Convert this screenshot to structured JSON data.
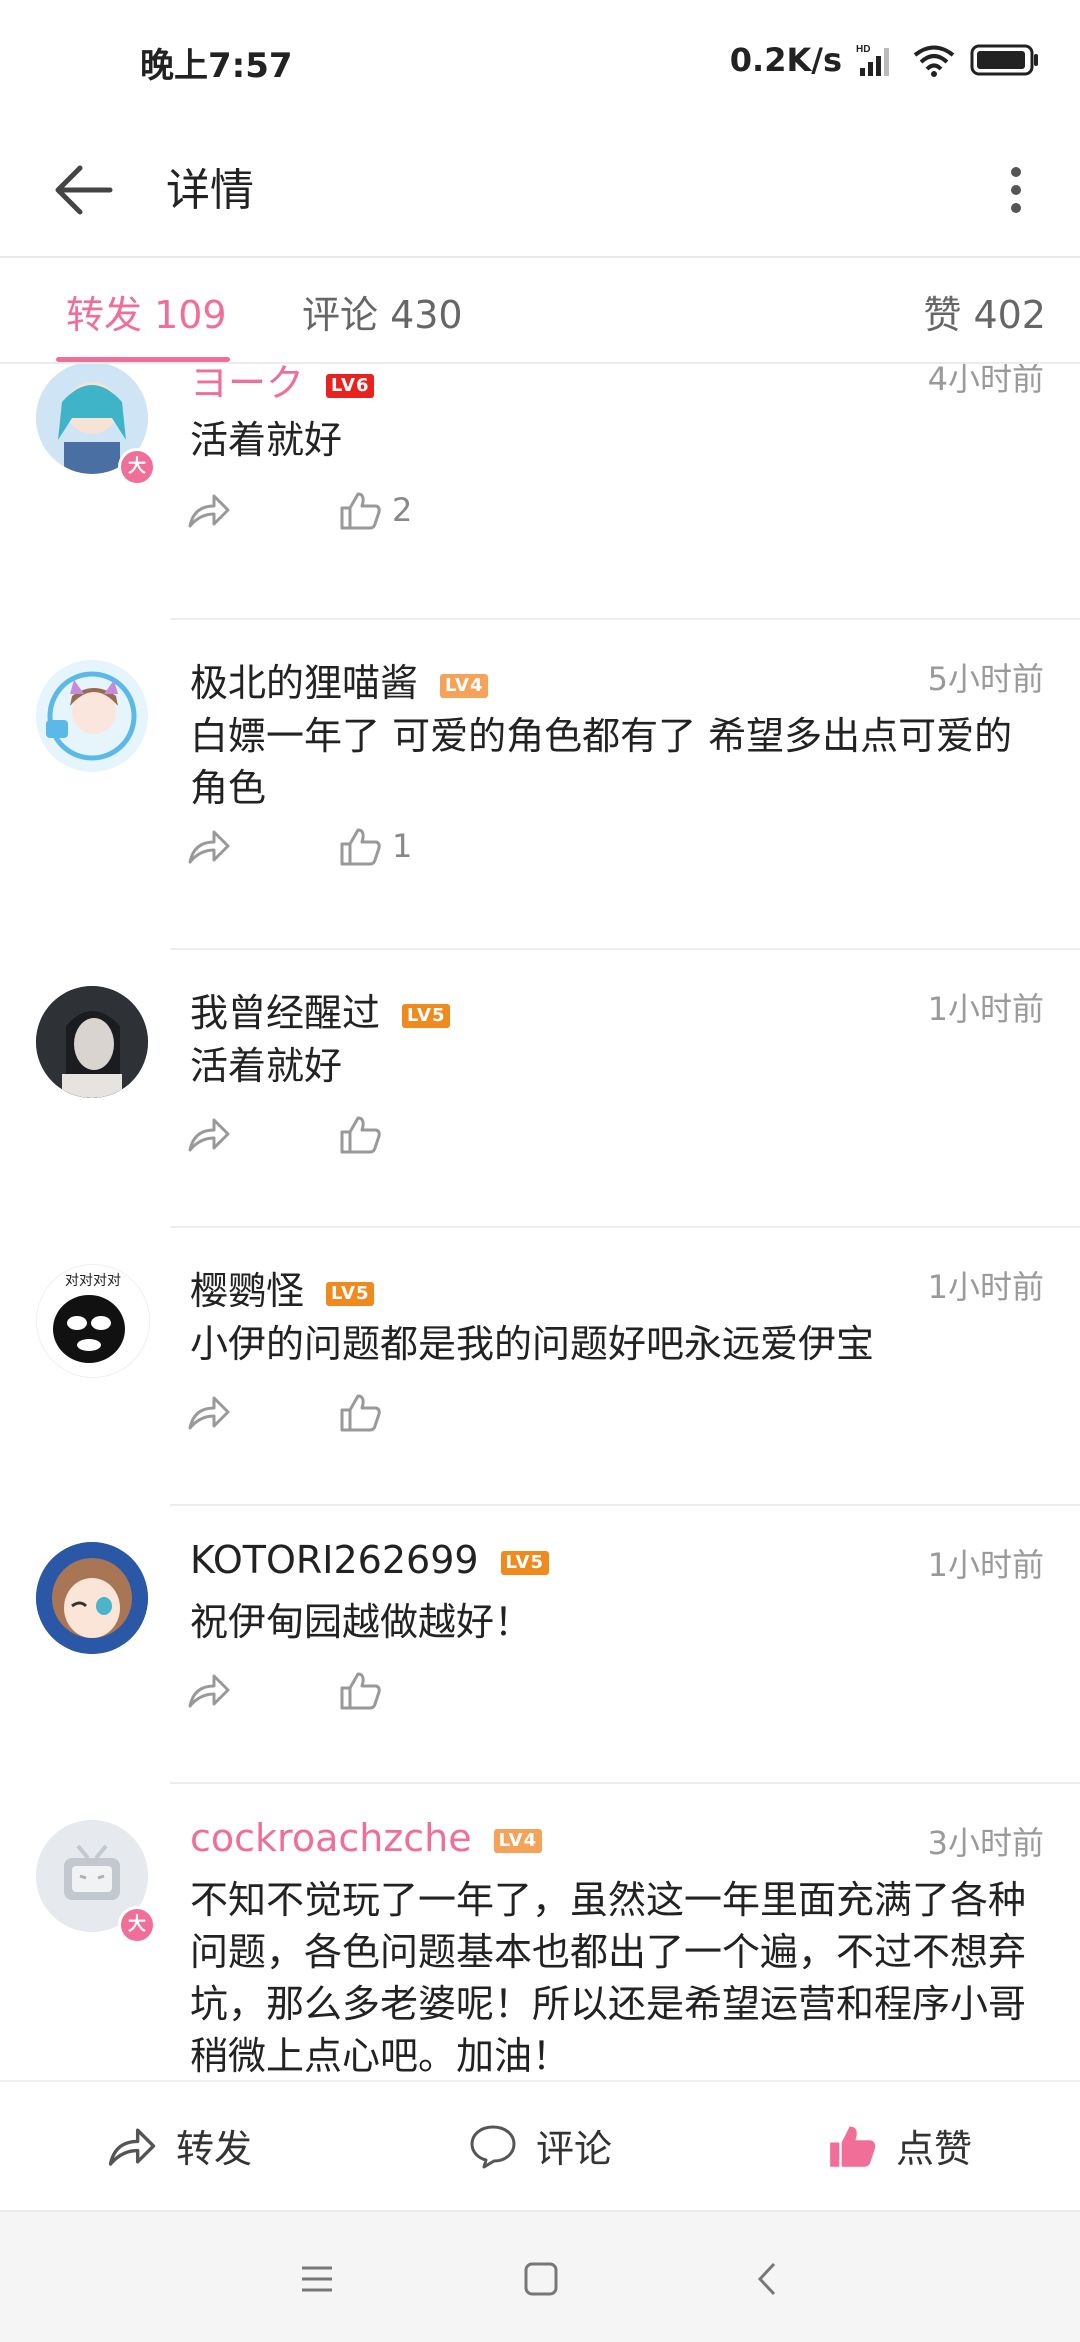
{
  "status": {
    "time": "晚上7:57",
    "net_speed": "0.2K/s"
  },
  "header": {
    "title": "详情"
  },
  "tabs": [
    {
      "label": "转发 109"
    },
    {
      "label": "评论 430"
    },
    {
      "label": "赞 402"
    }
  ],
  "comments": [
    {
      "username": "ヨーク",
      "level": "LV6",
      "time": "4小时前",
      "text": "活着就好",
      "likes": "2"
    },
    {
      "username": "极北的狸喵酱",
      "level": "LV4",
      "time": "5小时前",
      "text": "白嫖一年了 可爱的角色都有了 希望多出点可爱的角色",
      "likes": "1"
    },
    {
      "username": "我曾经醒过",
      "level": "LV5",
      "time": "1小时前",
      "text": "活着就好",
      "likes": ""
    },
    {
      "username": "樱鹦怪",
      "level": "LV5",
      "time": "1小时前",
      "text": "小伊的问题都是我的问题好吧永远爱伊宝",
      "likes": "",
      "avatar_text": "对对对对"
    },
    {
      "username": "KOTORI262699",
      "level": "LV5",
      "time": "1小时前",
      "text": "祝伊甸园越做越好！",
      "likes": ""
    },
    {
      "username": "cockroachzche",
      "level": "LV4",
      "time": "3小时前",
      "text": "不知不觉玩了一年了，虽然这一年里面充满了各种问题，各色问题基本也都出了一个遍，不过不想弃坑，那么多老婆呢！所以还是希望运营和程序小哥稍微上点心吧。加油！",
      "likes": ""
    }
  ],
  "vip_badge": "大",
  "action_bar": {
    "repost": "转发",
    "comment": "评论",
    "like": "点赞"
  },
  "colors": {
    "accent": "#f06e97",
    "lv4": "#f6a35a",
    "lv5": "#ef8a1f",
    "lv6": "#e8231f"
  },
  "icons": [
    "back-arrow-icon",
    "more-vert-icon",
    "share-icon",
    "thumb-up-icon",
    "chat-bubble-icon",
    "menu-icon",
    "home-square-icon",
    "back-chevron-icon"
  ]
}
